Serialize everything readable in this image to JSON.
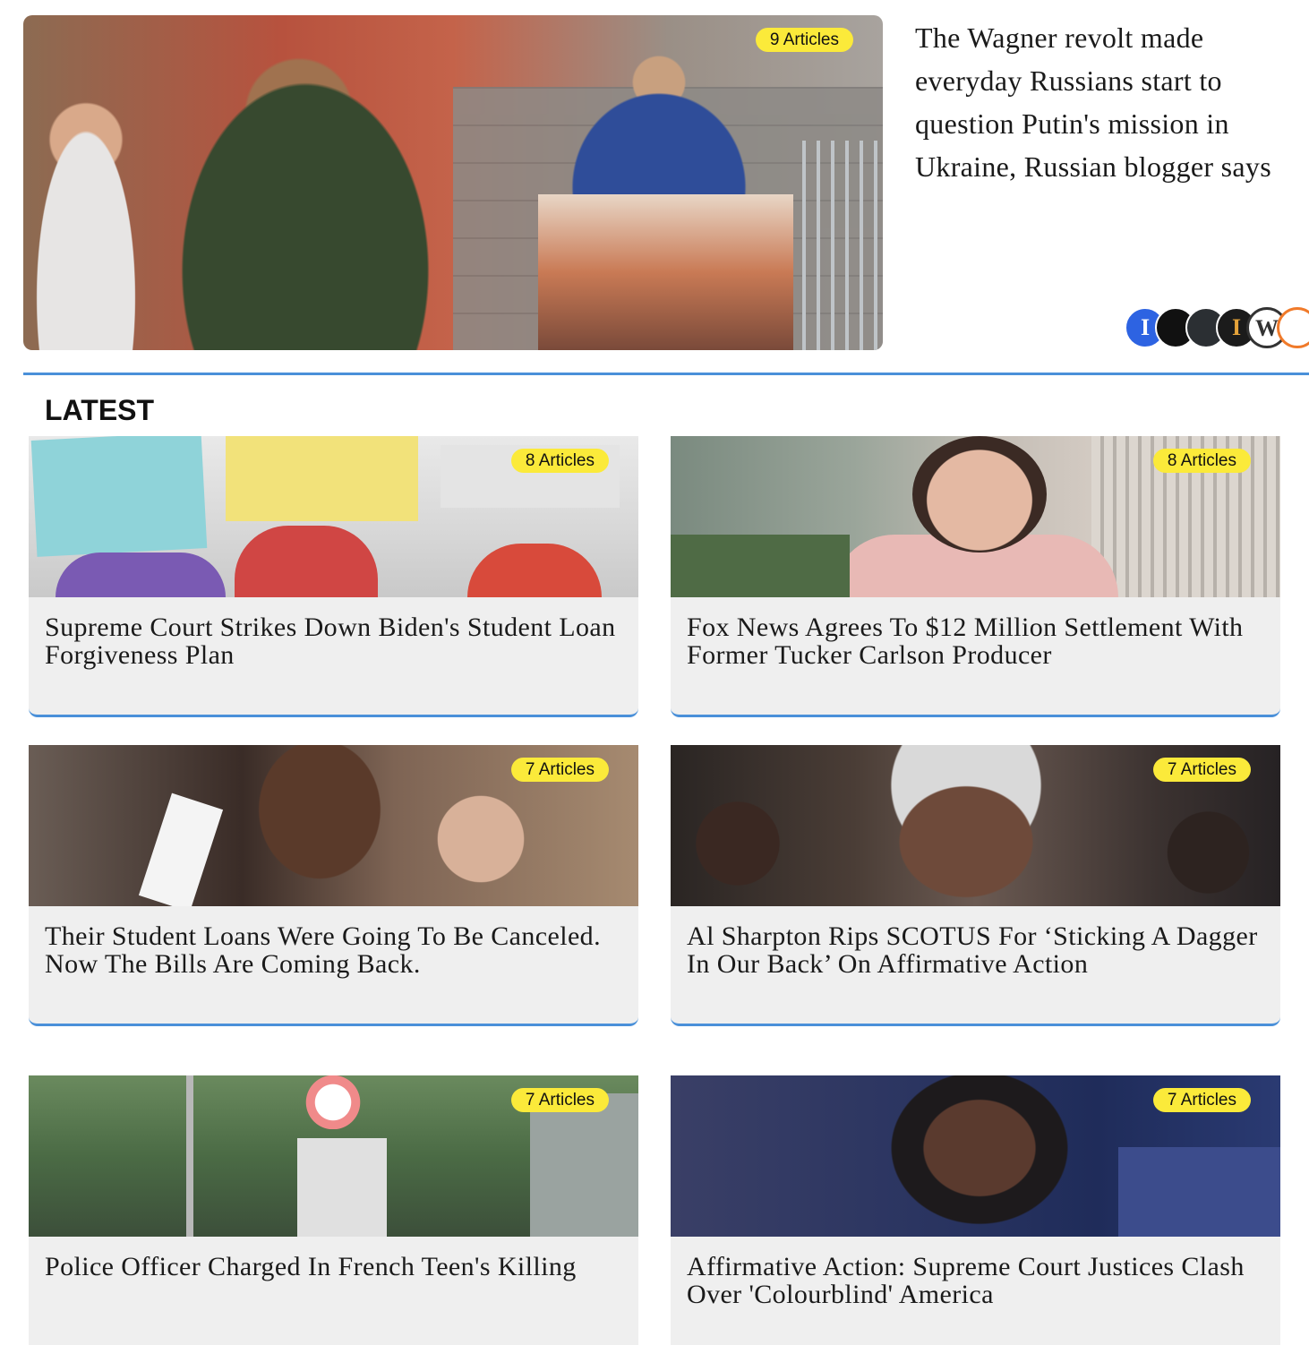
{
  "hero": {
    "badge": "9 Articles",
    "title": "The Wagner revolt made everyday Russians start to question Putin's mission in Ukraine, Russian blogger says",
    "sources": [
      {
        "icon": "source-logo-1-icon",
        "glyph": "I",
        "color": "#2d63e2",
        "fg": "#ffffff"
      },
      {
        "icon": "source-logo-2-icon",
        "glyph": "",
        "color": "#111111",
        "fg": "#ffffff"
      },
      {
        "icon": "source-logo-3-icon",
        "glyph": "",
        "color": "#2b2f33",
        "fg": "#ffffff"
      },
      {
        "icon": "source-logo-4-icon",
        "glyph": "I",
        "color": "#1b1b1b",
        "fg": "#e5a33a"
      },
      {
        "icon": "source-logo-5-icon",
        "glyph": "W",
        "color": "#ffffff",
        "fg": "#333333"
      },
      {
        "icon": "source-logo-6-icon",
        "glyph": "",
        "color": "#ffffff",
        "fg": "#f07a2a"
      }
    ]
  },
  "section": {
    "title": "LATEST"
  },
  "cards": [
    {
      "badge": "8 Articles",
      "title": "Supreme Court Strikes Down Biden's Student Loan Forgiveness Plan"
    },
    {
      "badge": "8 Articles",
      "title": "Fox News Agrees To $12 Million Settlement With Former Tucker Carlson Producer"
    },
    {
      "badge": "7 Articles",
      "title": "Their Student Loans Were Going To Be Canceled. Now The Bills Are Coming Back."
    },
    {
      "badge": "7 Articles",
      "title": "Al Sharpton Rips SCOTUS For ‘Sticking A Dagger In Our Back’ On Affirmative Action"
    },
    {
      "badge": "7 Articles",
      "title": "Police Officer Charged In French Teen's Killing"
    },
    {
      "badge": "7 Articles",
      "title": "Affirmative Action: Supreme Court Justices Clash Over 'Colourblind' America"
    }
  ],
  "colors": {
    "accent": "#4a90d9",
    "badge": "#fbea3a",
    "card_bg": "#efefef"
  }
}
